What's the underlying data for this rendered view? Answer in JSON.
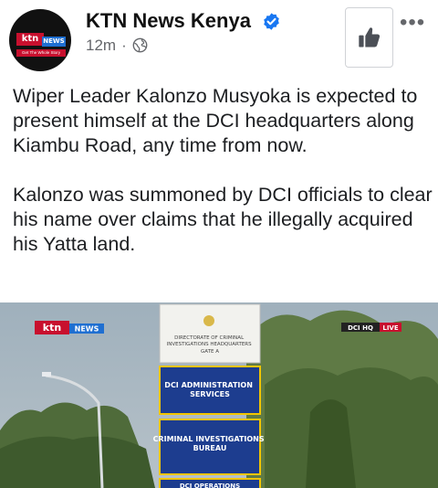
{
  "post": {
    "page_name": "KTN News Kenya",
    "time": "12m",
    "separator": "·",
    "paragraphs": [
      "Wiper Leader Kalonzo Musyoka is expected to present himself at the DCI headquarters along Kiambu Road, any time from now.",
      "Kalonzo was summoned by DCI officials to clear his name over claims that he illegally acquired his Yatta land."
    ]
  },
  "avatar": {
    "brand": "ktn",
    "brand_suffix": "NEWS",
    "tagline": "Get The Whole Story"
  },
  "image": {
    "brand": "ktn",
    "brand_suffix": "NEWS",
    "live_badge": "DCI HQ",
    "live_label": "LIVE",
    "sign_header": "DIRECTORATE OF CRIMINAL INVESTIGATIONS HEADQUARTERS",
    "sign_sub": "GATE A",
    "sign_1": "DCI ADMINISTRATION SERVICES",
    "sign_2": "CRIMINAL INVESTIGATIONS BUREAU",
    "sign_3": "DCI OPERATIONS"
  },
  "icons": {
    "verified": "verified-check-icon",
    "globe": "globe-icon",
    "like": "thumbs-up-icon",
    "more": "more-options-icon"
  },
  "colors": {
    "verified_blue": "#1877f2",
    "brand_red": "#c8102e",
    "brand_blue": "#1f6fd1",
    "sign_blue": "#1d3d8f"
  }
}
